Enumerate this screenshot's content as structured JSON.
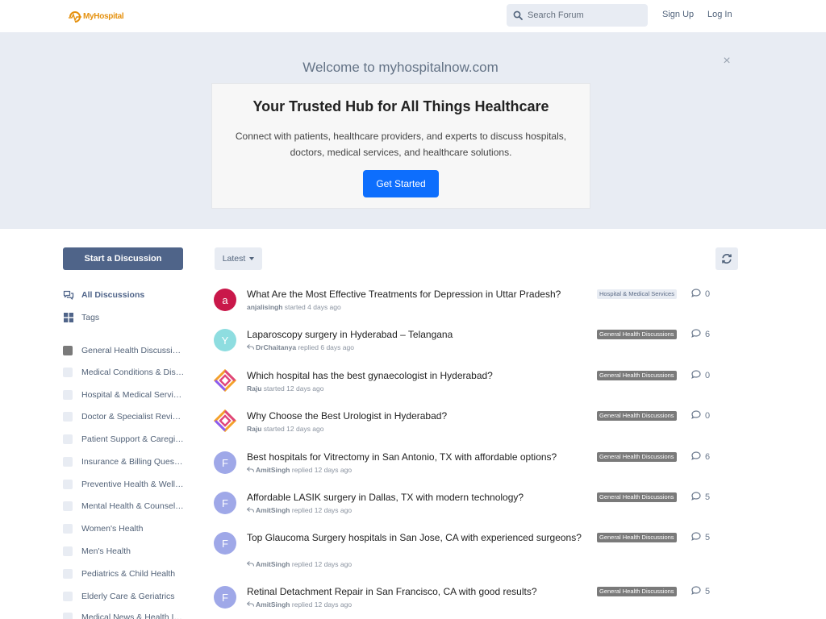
{
  "header": {
    "logo_text": "MyHospital",
    "search_placeholder": "Search Forum",
    "signup": "Sign Up",
    "login": "Log In"
  },
  "hero": {
    "welcome": "Welcome to myhospitalnow.com",
    "close": "×",
    "heading": "Your Trusted Hub for All Things Healthcare",
    "text": "Connect with patients, healthcare providers, and experts to discuss hospitals, doctors, medical services, and healthcare solutions.",
    "cta": "Get Started"
  },
  "sidebar": {
    "start_discussion": "Start a Discussion",
    "nav": [
      {
        "label": "All Discussions",
        "icon": "chat-bubbles-icon",
        "active": true
      },
      {
        "label": "Tags",
        "icon": "tags-grid-icon",
        "active": false
      }
    ],
    "tags": [
      "General Health Discussions",
      "Medical Conditions & Diseases",
      "Hospital & Medical Services",
      "Doctor & Specialist Reviews",
      "Patient Support & Caregivers",
      "Insurance & Billing Questions",
      "Preventive Health & Wellness",
      "Mental Health & Counseling",
      "Women's Health",
      "Men's Health",
      "Pediatrics & Child Health",
      "Elderly Care & Geriatrics",
      "Medical News & Health Innovations"
    ]
  },
  "toolbar": {
    "sort_label": "Latest"
  },
  "colors": {
    "primary": "#4f6489",
    "cta": "#0d6efd",
    "hero_bg": "#e8ecf3",
    "tag_general": "#7a7a7a"
  },
  "discussions": [
    {
      "title": "What Are the Most Effective Treatments for Depression in Uttar Pradesh?",
      "avatar": "a",
      "avatar_color": "#c9184a",
      "user": "anjalisingh",
      "action": "started",
      "time": "4 days ago",
      "tag": "Hospital & Medical Services",
      "tag_style": "light",
      "replies": "0",
      "reply_icon": false
    },
    {
      "title": "Laparoscopy surgery in Hyderabad – Telangana",
      "avatar": "Y",
      "avatar_color": "#8edde0",
      "user": "DrChaitanya",
      "action": "replied",
      "time": "6 days ago",
      "tag": "General Health Discussions",
      "tag_style": "gray",
      "replies": "6",
      "reply_icon": true
    },
    {
      "title": "Which hospital has the best gynaecologist in Hyderabad?",
      "avatar": "",
      "avatar_color": "logo",
      "user": "Raju",
      "action": "started",
      "time": "12 days ago",
      "tag": "General Health Discussions",
      "tag_style": "gray",
      "replies": "0",
      "reply_icon": false
    },
    {
      "title": "Why Choose the Best Urologist in Hyderabad?",
      "avatar": "",
      "avatar_color": "logo",
      "user": "Raju",
      "action": "started",
      "time": "12 days ago",
      "tag": "General Health Discussions",
      "tag_style": "gray",
      "replies": "0",
      "reply_icon": false
    },
    {
      "title": "Best hospitals for Vitrectomy in San Antonio, TX with affordable options?",
      "avatar": "F",
      "avatar_color": "#9fa8e8",
      "user": "AmitSingh",
      "action": "replied",
      "time": "12 days ago",
      "tag": "General Health Discussions",
      "tag_style": "gray",
      "replies": "6",
      "reply_icon": true
    },
    {
      "title": "Affordable LASIK surgery in Dallas, TX with modern technology?",
      "avatar": "F",
      "avatar_color": "#9fa8e8",
      "user": "AmitSingh",
      "action": "replied",
      "time": "12 days ago",
      "tag": "General Health Discussions",
      "tag_style": "gray",
      "replies": "5",
      "reply_icon": true
    },
    {
      "title": "Top Glaucoma Surgery hospitals in San Jose, CA with experienced surgeons?",
      "avatar": "F",
      "avatar_color": "#9fa8e8",
      "user": "AmitSingh",
      "action": "replied",
      "time": "12 days ago",
      "tag": "General Health Discussions",
      "tag_style": "gray",
      "replies": "5",
      "reply_icon": true
    },
    {
      "title": "Retinal Detachment Repair in San Francisco, CA with good results?",
      "avatar": "F",
      "avatar_color": "#9fa8e8",
      "user": "AmitSingh",
      "action": "replied",
      "time": "12 days ago",
      "tag": "General Health Discussions",
      "tag_style": "gray",
      "replies": "5",
      "reply_icon": true
    }
  ]
}
